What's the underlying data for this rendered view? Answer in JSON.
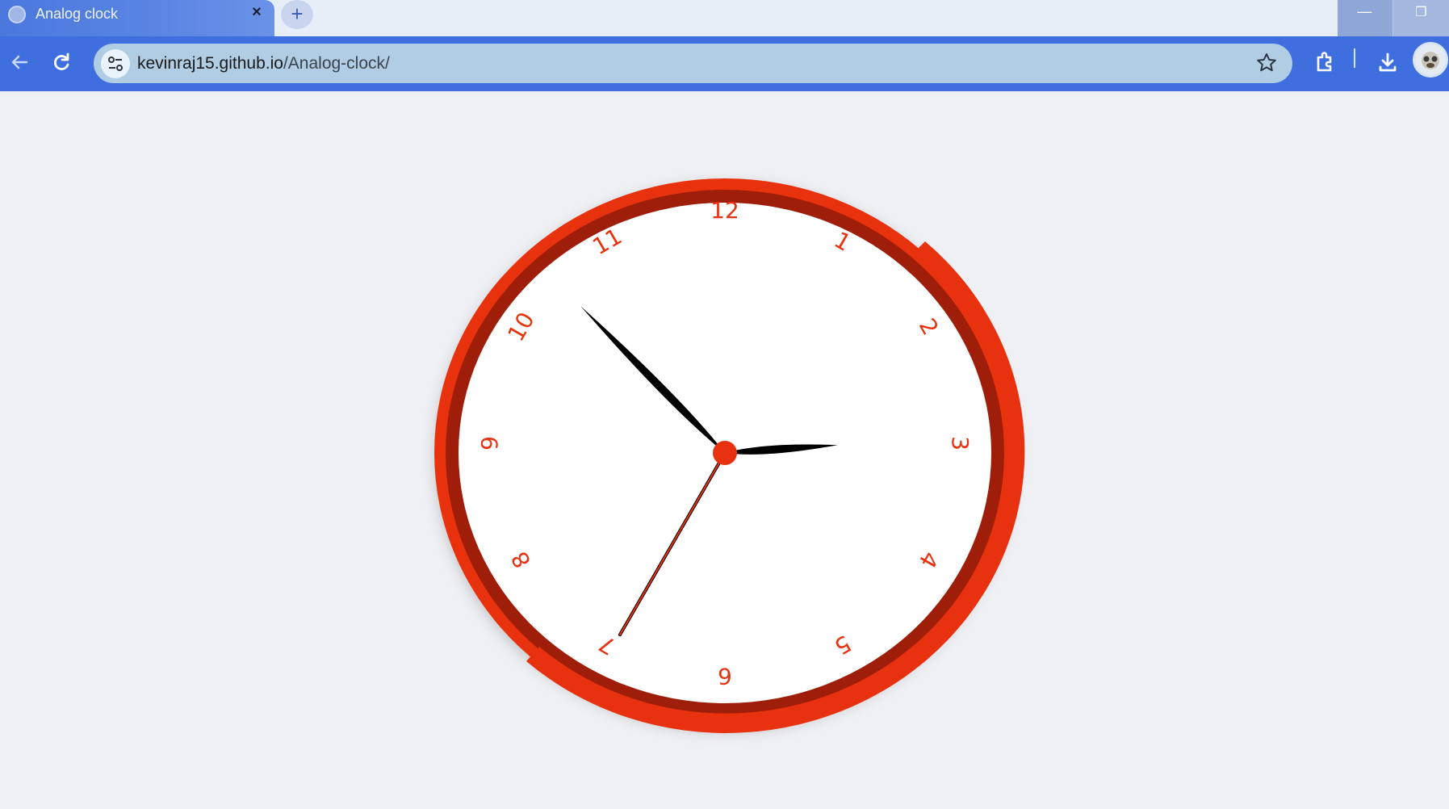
{
  "browser": {
    "tab_title": "Analog clock",
    "close_glyph": "×",
    "newtab_glyph": "+",
    "minimize_glyph": "—",
    "maximize_glyph": "❐",
    "url_host": "kevinraj15.github.io",
    "url_path": "/Analog-clock/",
    "icons": [
      "back-arrow-icon",
      "reload-icon",
      "site-info-icon",
      "bookmark-star-icon",
      "extensions-icon",
      "download-icon"
    ]
  },
  "clock": {
    "numbers": [
      "12",
      "1",
      "2",
      "3",
      "4",
      "5",
      "6",
      "7",
      "8",
      "9",
      "10",
      "11"
    ],
    "time": {
      "hours": 2,
      "minutes": 52,
      "seconds": 35
    },
    "colors": {
      "rim_outer": "#e8320f",
      "rim_inner": "#9e1e0a",
      "face": "#ffffff",
      "numbers": "#e8320f",
      "hands": "#000000",
      "second_hand": "#e8320f",
      "center": "#e8320f"
    }
  }
}
